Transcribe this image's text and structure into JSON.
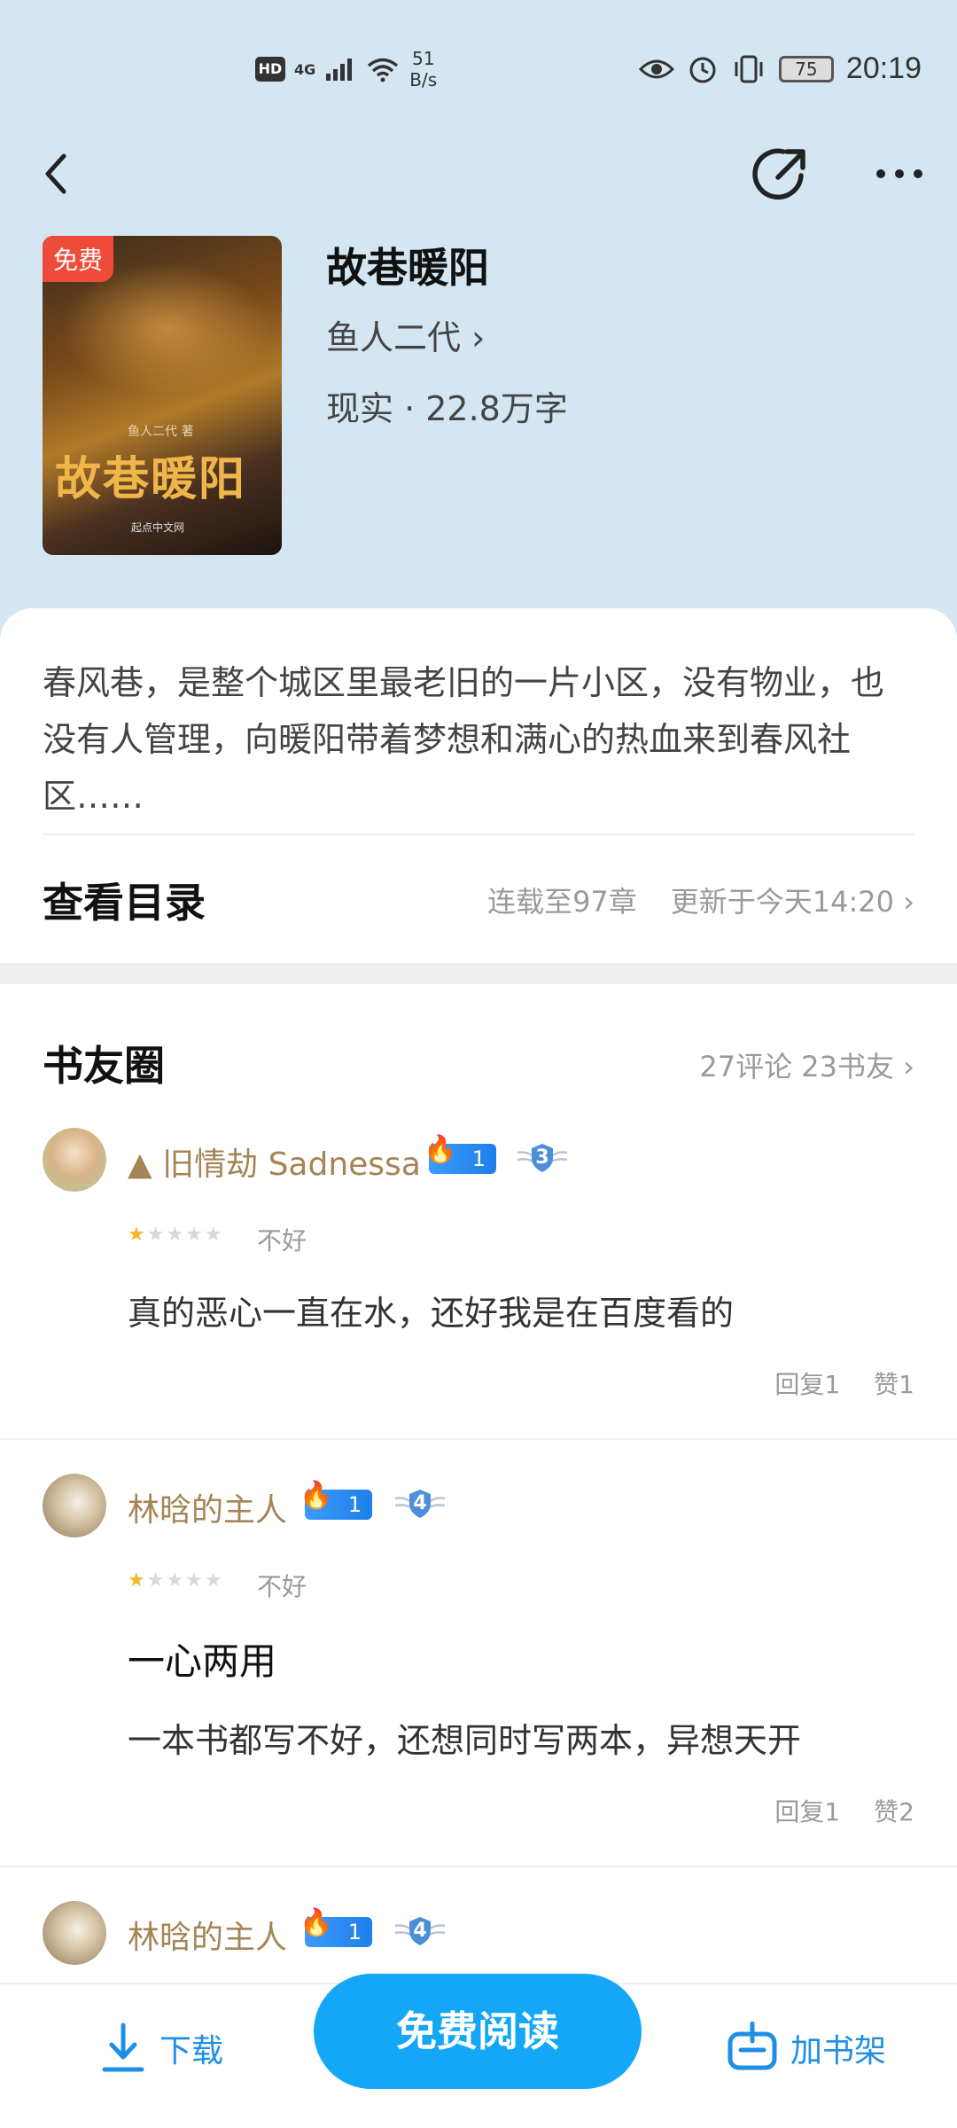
{
  "status_bar": {
    "hd": "HD",
    "net": "4G",
    "speed_value": "51",
    "speed_unit": "B/s",
    "battery": "75",
    "time": "20:19"
  },
  "nav": {
    "back_icon": "chevron-left-icon",
    "share_icon": "share-icon",
    "more_icon": "more-dots-icon"
  },
  "book": {
    "badge": "免费",
    "cover_title": "故巷暖阳",
    "cover_author": "鱼人二代 著",
    "cover_logo": "起点中文网",
    "title": "故巷暖阳",
    "author": "鱼人二代 ›",
    "meta": "现实 · 22.8万字",
    "description": "春风巷，是整个城区里最老旧的一片小区，没有物业，也没有人管理，向暖阳带着梦想和满心的热血来到春风社区……"
  },
  "catalog": {
    "title": "查看目录",
    "chapters": "连载至97章",
    "updated": "更新于今天14:20 ›"
  },
  "circle": {
    "title": "书友圈",
    "stats": "27评论 23书友 ›"
  },
  "comments": [
    {
      "user": "▲ 旧情劫 Sadnessa",
      "level": "1",
      "medal": "3",
      "rating": 1,
      "rating_label": "不好",
      "title": "",
      "text": "真的恶心一直在水，还好我是在百度看的",
      "reply": "回复1",
      "like": "赞1"
    },
    {
      "user": "林晗的主人",
      "level": "1",
      "medal": "4",
      "rating": 1,
      "rating_label": "不好",
      "title": "一心两用",
      "text": "一本书都写不好，还想同时写两本，异想天开",
      "reply": "回复1",
      "like": "赞2"
    },
    {
      "user": "林晗的主人",
      "level": "1",
      "medal": "4"
    }
  ],
  "bottom": {
    "download": "下载",
    "read": "免费阅读",
    "shelf": "加书架"
  },
  "colors": {
    "header_bg": "#d3e6f1",
    "accent": "#14a7f8",
    "username": "#a58455",
    "free_badge": "#ee4b3a"
  }
}
